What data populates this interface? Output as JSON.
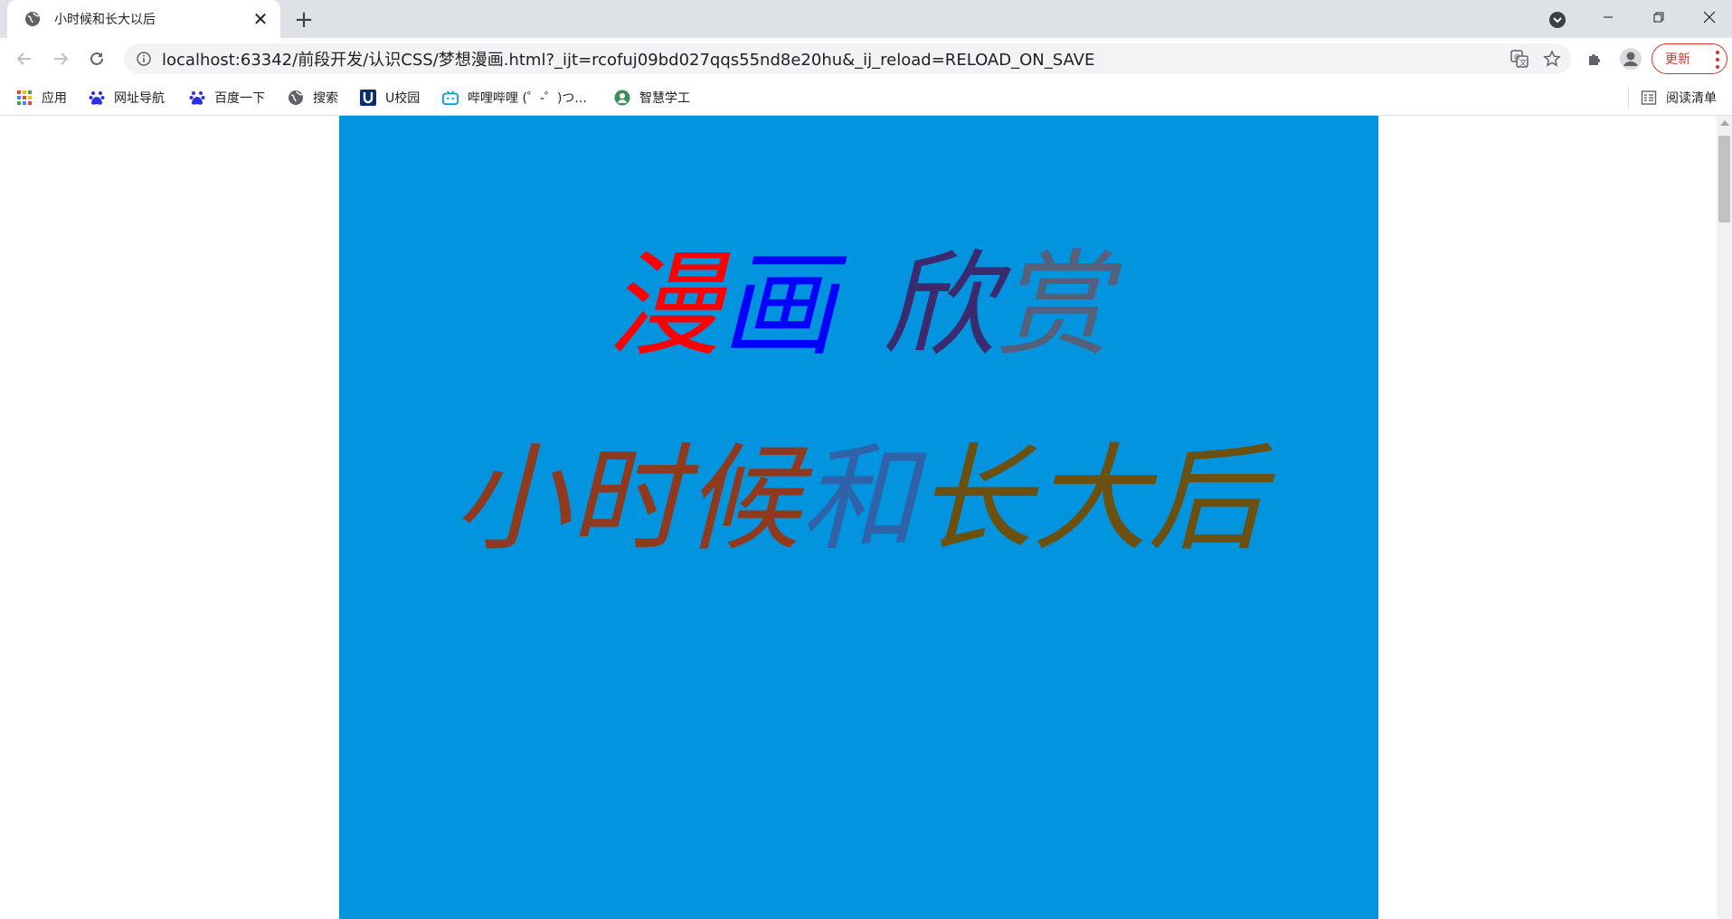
{
  "tab": {
    "title": "小时候和长大以后",
    "close_glyph": "✕"
  },
  "newtab_glyph": "+",
  "window_controls": {
    "minimize": "–",
    "restore": "❐",
    "close": "✕"
  },
  "omnibox": {
    "url": "localhost:63342/前段开发/认识CSS/梦想漫画.html?_ijt=rcofuj09bd027qqs55nd8e20hu&_ij_reload=RELOAD_ON_SAVE"
  },
  "update_label": "更新",
  "bookmarks": [
    {
      "label": "应用",
      "icon": "apps-grid-icon"
    },
    {
      "label": "网址导航",
      "icon": "baidu-paw-icon"
    },
    {
      "label": "百度一下",
      "icon": "baidu-paw-icon"
    },
    {
      "label": "搜索",
      "icon": "globe-icon"
    },
    {
      "label": "U校园",
      "icon": "u-campus-icon"
    },
    {
      "label": "哔哩哔哩 (゜-゜)つ...",
      "icon": "bilibili-tv-icon"
    },
    {
      "label": "智慧学工",
      "icon": "person-logo-icon"
    }
  ],
  "reading_list_label": "阅读清单",
  "page": {
    "heading1": [
      {
        "text": "漫",
        "color": "#ff0000"
      },
      {
        "text": "画",
        "color": "#0000ff"
      },
      {
        "text": "欣",
        "color": "#3b2a6e"
      },
      {
        "text": "赏",
        "color": "#55607a"
      }
    ],
    "heading2": [
      {
        "text": "小时候",
        "color": "#8f3a1e"
      },
      {
        "text": "和",
        "color": "#2f62a8"
      },
      {
        "text": "长大后",
        "color": "#6b5010"
      }
    ],
    "background_color": "#0394e0"
  }
}
